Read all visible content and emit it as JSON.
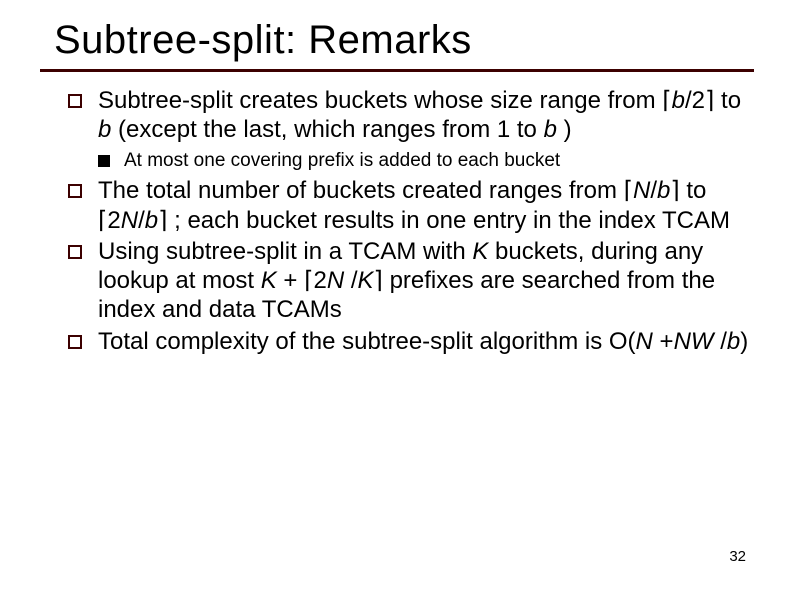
{
  "title": "Subtree-split: Remarks",
  "bullets": {
    "b1": {
      "pre": "Subtree-split creates buckets whose size range from ⌈",
      "m1": "b",
      "mid1": "/2⌉ to ",
      "m2": "b",
      "mid2": " (except the last, which ranges from 1 to ",
      "m3": "b",
      "post": " )"
    },
    "b1s": "At most one covering prefix is added to each bucket",
    "b2": {
      "pre": "The total number of buckets created ranges from ⌈",
      "m1": "N",
      "mid1": "/",
      "m2": "b",
      "mid2": "⌉ to ⌈2",
      "m3": "N",
      "mid3": "/",
      "m4": "b",
      "post": "⌉ ; each bucket results in one entry in the index TCAM"
    },
    "b3": {
      "pre": "Using subtree-split in a TCAM with ",
      "m1": "K",
      "mid1": "  buckets, during any lookup at most ",
      "m2": "K",
      "mid2": " + ⌈2",
      "m3": "N",
      "mid3": " /",
      "m4": "K",
      "post": "⌉ prefixes are searched from the index and data TCAMs"
    },
    "b4": {
      "pre": "Total complexity of the subtree-split algorithm is O(",
      "m1": "N",
      "mid1": " +",
      "m2": "NW",
      "mid2": " /",
      "m3": "b",
      "post": ")"
    }
  },
  "page": "32"
}
